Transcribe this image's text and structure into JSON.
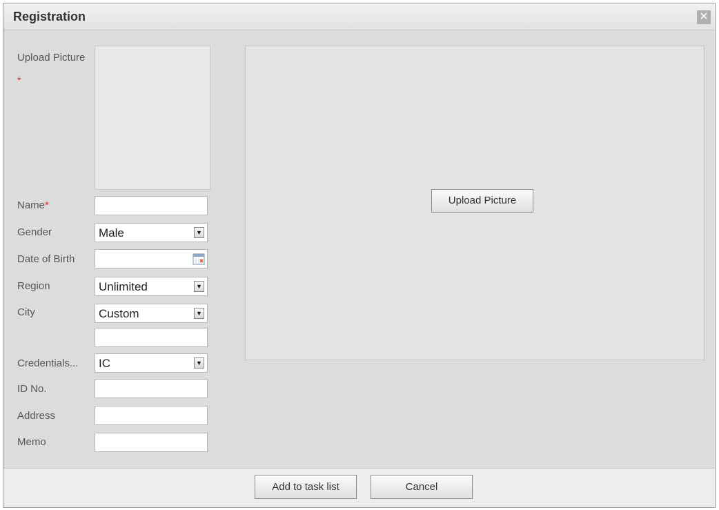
{
  "dialog": {
    "title": "Registration",
    "close_icon": "close-icon"
  },
  "form": {
    "upload_picture_label": "Upload Picture",
    "required_mark": "*",
    "name_label": "Name",
    "name_value": "",
    "gender_label": "Gender",
    "gender_value": "Male",
    "dob_label": "Date of Birth",
    "dob_value": "",
    "region_label": "Region",
    "region_value": "Unlimited",
    "city_label": "City",
    "city_value": "Custom",
    "city_custom_value": "",
    "credentials_label": "Credentials...",
    "credentials_value": "IC",
    "id_label": "ID No.",
    "id_value": "",
    "address_label": "Address",
    "address_value": "",
    "memo_label": "Memo",
    "memo_value": ""
  },
  "preview": {
    "upload_button": "Upload Picture"
  },
  "footer": {
    "add_button": "Add to task list",
    "cancel_button": "Cancel"
  },
  "colors": {
    "required": "#d33333",
    "dialog_bg": "#dcdcdc"
  }
}
